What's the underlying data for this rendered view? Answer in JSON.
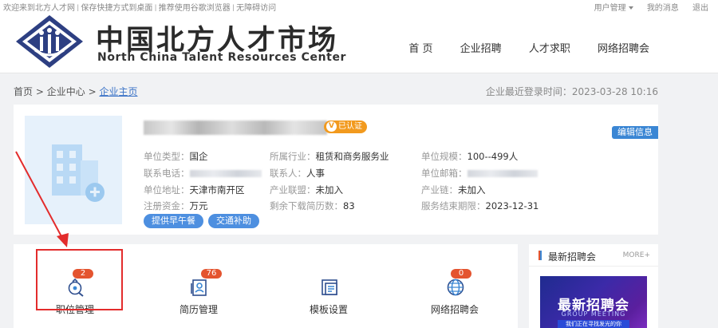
{
  "topbar": {
    "links": [
      "欢迎来到北方人才网",
      "保存快捷方式到桌面",
      "推荐使用谷歌浏览器",
      "无障碍访问"
    ],
    "separator": "|",
    "user_menu": "用户管理",
    "messages": "我的消息",
    "logout": "退出"
  },
  "header": {
    "title": "中国北方人才市场",
    "subtitle": "North China Talent Resources Center",
    "nav": [
      "首 页",
      "企业招聘",
      "人才求职",
      "网络招聘会"
    ]
  },
  "breadcrumb": {
    "home": "首页",
    "sep": ">",
    "center": "企业中心",
    "current": "企业主页",
    "last_login_label": "企业最近登录时间：",
    "last_login_value": "2023-03-28 10:16"
  },
  "company": {
    "verified": "已认证",
    "verified_mark": "V",
    "edit_button": "编辑信息",
    "fields": {
      "type_label": "单位类型：",
      "type_value": "国企",
      "industry_label": "所属行业：",
      "industry_value": "租赁和商务服务业",
      "scale_label": "单位规模：",
      "scale_value": "100--499人",
      "phone_label": "联系电话：",
      "contact_label": "联系人：",
      "contact_value": "人事",
      "email_label": "单位邮箱：",
      "address_label": "单位地址：",
      "address_value": "天津市南开区",
      "alliance_label": "产业联盟：",
      "alliance_value": "未加入",
      "chain_label": "产业链：",
      "chain_value": "未加入",
      "capital_label": "注册资金：",
      "capital_value": "万元",
      "downloads_label": "剩余下载简历数：",
      "downloads_value": "83",
      "service_end_label": "服务结束期限：",
      "service_end_value": "2023-12-31"
    },
    "tags": [
      "提供早午餐",
      "交通补助"
    ]
  },
  "functions": [
    {
      "label": "职位管理",
      "badge": "2",
      "icon": "job-bag-icon"
    },
    {
      "label": "简历管理",
      "badge": "76",
      "icon": "resume-icon"
    },
    {
      "label": "模板设置",
      "badge": "",
      "icon": "template-icon"
    },
    {
      "label": "网络招聘会",
      "badge": "0",
      "icon": "globe-icon"
    }
  ],
  "aside": {
    "title": "最新招聘会",
    "more": "MORE+",
    "banner_title": "最新招聘会",
    "banner_sub": "GROUP MEETING",
    "banner_cta": "我们正在寻找发光的你"
  },
  "colors": {
    "accent_blue": "#3a86d4",
    "badge_red": "#e4542f",
    "verified_orange": "#f29a1e",
    "annotation_red": "#e32c2c"
  }
}
